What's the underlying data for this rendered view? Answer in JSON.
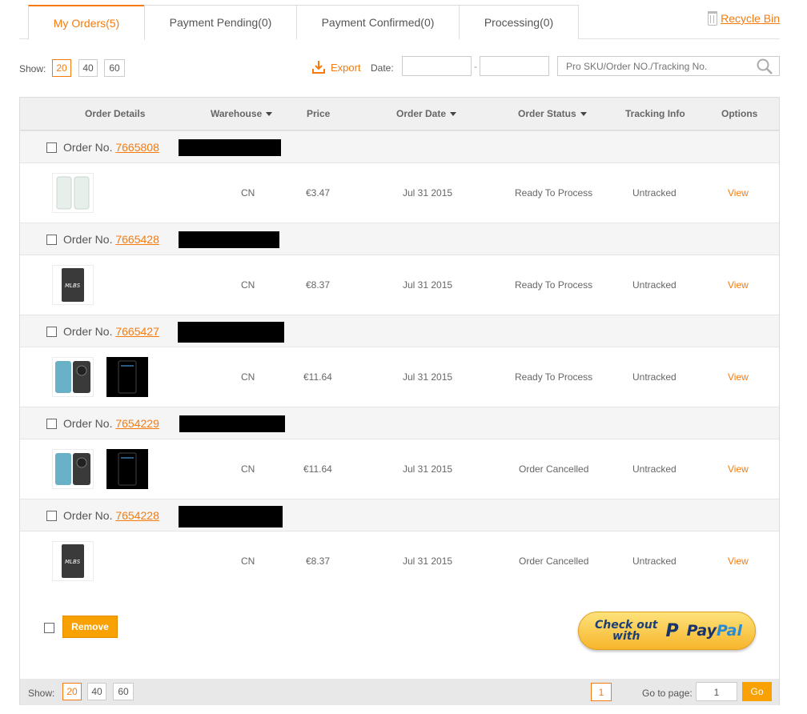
{
  "tabs": [
    {
      "label": "My Orders(5)",
      "active": true
    },
    {
      "label": "Payment Pending(0)",
      "active": false
    },
    {
      "label": "Payment Confirmed(0)",
      "active": false
    },
    {
      "label": "Processing(0)",
      "active": false
    }
  ],
  "recycle_bin": "Recycle Bin",
  "toolbar": {
    "show_label": "Show:",
    "page_sizes": [
      "20",
      "40",
      "60"
    ],
    "export_label": "Export",
    "date_label": "Date:",
    "date_separator": "-",
    "search_placeholder": "Pro SKU/Order NO./Tracking No."
  },
  "table": {
    "headers": {
      "order_details": "Order Details",
      "warehouse": "Warehouse",
      "price": "Price",
      "order_date": "Order Date",
      "order_status": "Order Status",
      "tracking_info": "Tracking Info",
      "options": "Options"
    },
    "order_no_label": "Order No.",
    "orders": [
      {
        "number": "7665808",
        "warehouse": "CN",
        "price": "€3.47",
        "date": "Jul 31 2015",
        "status": "Ready To Process",
        "tracking": "Untracked",
        "option": "View"
      },
      {
        "number": "7665428",
        "warehouse": "CN",
        "price": "€8.37",
        "date": "Jul 31 2015",
        "status": "Ready To Process",
        "tracking": "Untracked",
        "option": "View"
      },
      {
        "number": "7665427",
        "warehouse": "CN",
        "price": "€11.64",
        "date": "Jul 31 2015",
        "status": "Ready To Process",
        "tracking": "Untracked",
        "option": "View"
      },
      {
        "number": "7654229",
        "warehouse": "CN",
        "price": "€11.64",
        "date": "Jul 31 2015",
        "status": "Order Cancelled",
        "tracking": "Untracked",
        "option": "View"
      },
      {
        "number": "7654228",
        "warehouse": "CN",
        "price": "€8.37",
        "date": "Jul 31 2015",
        "status": "Order Cancelled",
        "tracking": "Untracked",
        "option": "View"
      }
    ]
  },
  "footer": {
    "remove_label": "Remove",
    "paypal": {
      "line1": "Check out",
      "line2": "with",
      "brand_a": "Pay",
      "brand_b": "Pal"
    },
    "show_label": "Show:",
    "page_sizes": [
      "20",
      "40",
      "60"
    ],
    "current_page": "1",
    "goto_label": "Go to page:",
    "goto_value": "1",
    "go_label": "Go"
  },
  "colors": {
    "accent": "#f57b0f",
    "button": "#f9a100"
  }
}
